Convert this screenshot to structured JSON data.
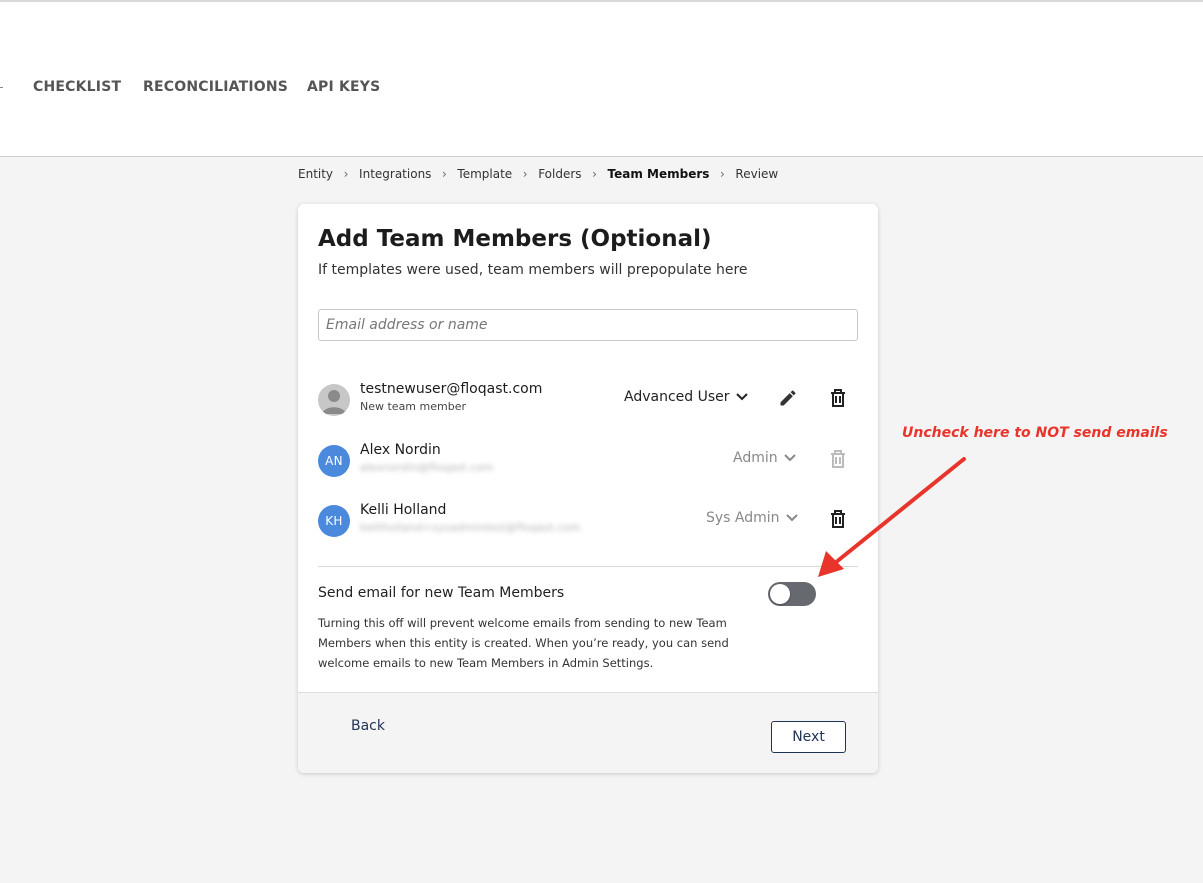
{
  "nav": {
    "tabs": [
      "CHECKLIST",
      "RECONCILIATIONS",
      "API KEYS"
    ]
  },
  "breadcrumb": [
    "Entity",
    "Integrations",
    "Template",
    "Folders",
    "Team Members",
    "Review"
  ],
  "breadcrumb_active": "Team Members",
  "card": {
    "title": "Add Team Members (Optional)",
    "subtitle": "If templates were used, team members will prepopulate here",
    "search_placeholder": "Email address or name"
  },
  "members": [
    {
      "initials": "",
      "name": "testnewuser@floqast.com",
      "sub": "New team member",
      "role": "Advanced User",
      "avatar_icon": "user-silhouette-icon"
    },
    {
      "initials": "AN",
      "name": "Alex Nordin",
      "sub": "alexnordin@floqast.com",
      "role": "Admin"
    },
    {
      "initials": "KH",
      "name": "Kelli Holland",
      "sub": "kelliholland+sysadmintest@floqast.com",
      "role": "Sys Admin"
    }
  ],
  "email_setting": {
    "label": "Send email for new Team Members",
    "description": "Turning this off will prevent welcome emails from sending to new Team Members when this entity is created. When you’re ready, you can send welcome emails to new Team Members in Admin Settings.",
    "enabled": false
  },
  "footer": {
    "back_label": "Back",
    "next_label": "Next"
  },
  "annotation": {
    "text": "Uncheck here to NOT send emails",
    "color": "#e8342a"
  },
  "colors": {
    "accent_navy": "#1f3355",
    "avatar_blue": "#4a89dc",
    "toggle_off": "#666a70"
  }
}
